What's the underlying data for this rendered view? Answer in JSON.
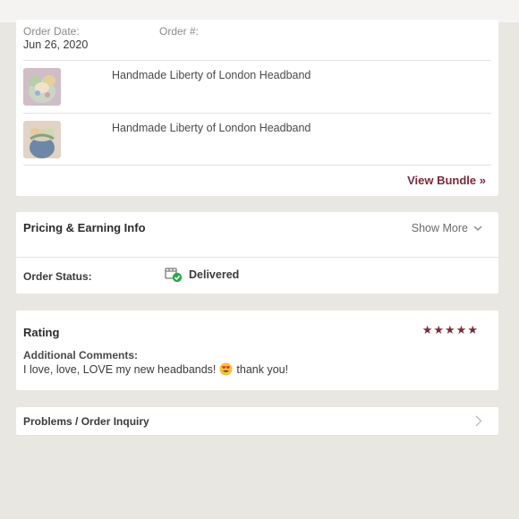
{
  "order": {
    "date_label": "Order Date:",
    "date_value": "Jun 26, 2020",
    "number_label": "Order #:",
    "items": [
      {
        "title": "Handmade Liberty of London Headband"
      },
      {
        "title": "Handmade Liberty of London Headband"
      }
    ],
    "view_bundle_label": "View Bundle »"
  },
  "pricing": {
    "title": "Pricing & Earning Info",
    "show_more_label": "Show More",
    "status_label": "Order Status:",
    "status_value": "Delivered"
  },
  "rating": {
    "title": "Rating",
    "stars": 5,
    "stars_text": "★★★★★",
    "comments_label": "Additional Comments:",
    "comment_part1": "I love, love, LOVE my new headbands!",
    "comment_part2": "thank you!"
  },
  "problems": {
    "label": "Problems / Order Inquiry"
  },
  "colors": {
    "accent": "#7c2a3a",
    "background": "#e9e7e2",
    "success": "#2ea84a"
  },
  "icons": {
    "status": "delivered-box-check-icon",
    "emoji": "heart-eyes-emoji-icon",
    "show_more": "chevron-down-icon",
    "problems": "chevron-right-icon"
  }
}
